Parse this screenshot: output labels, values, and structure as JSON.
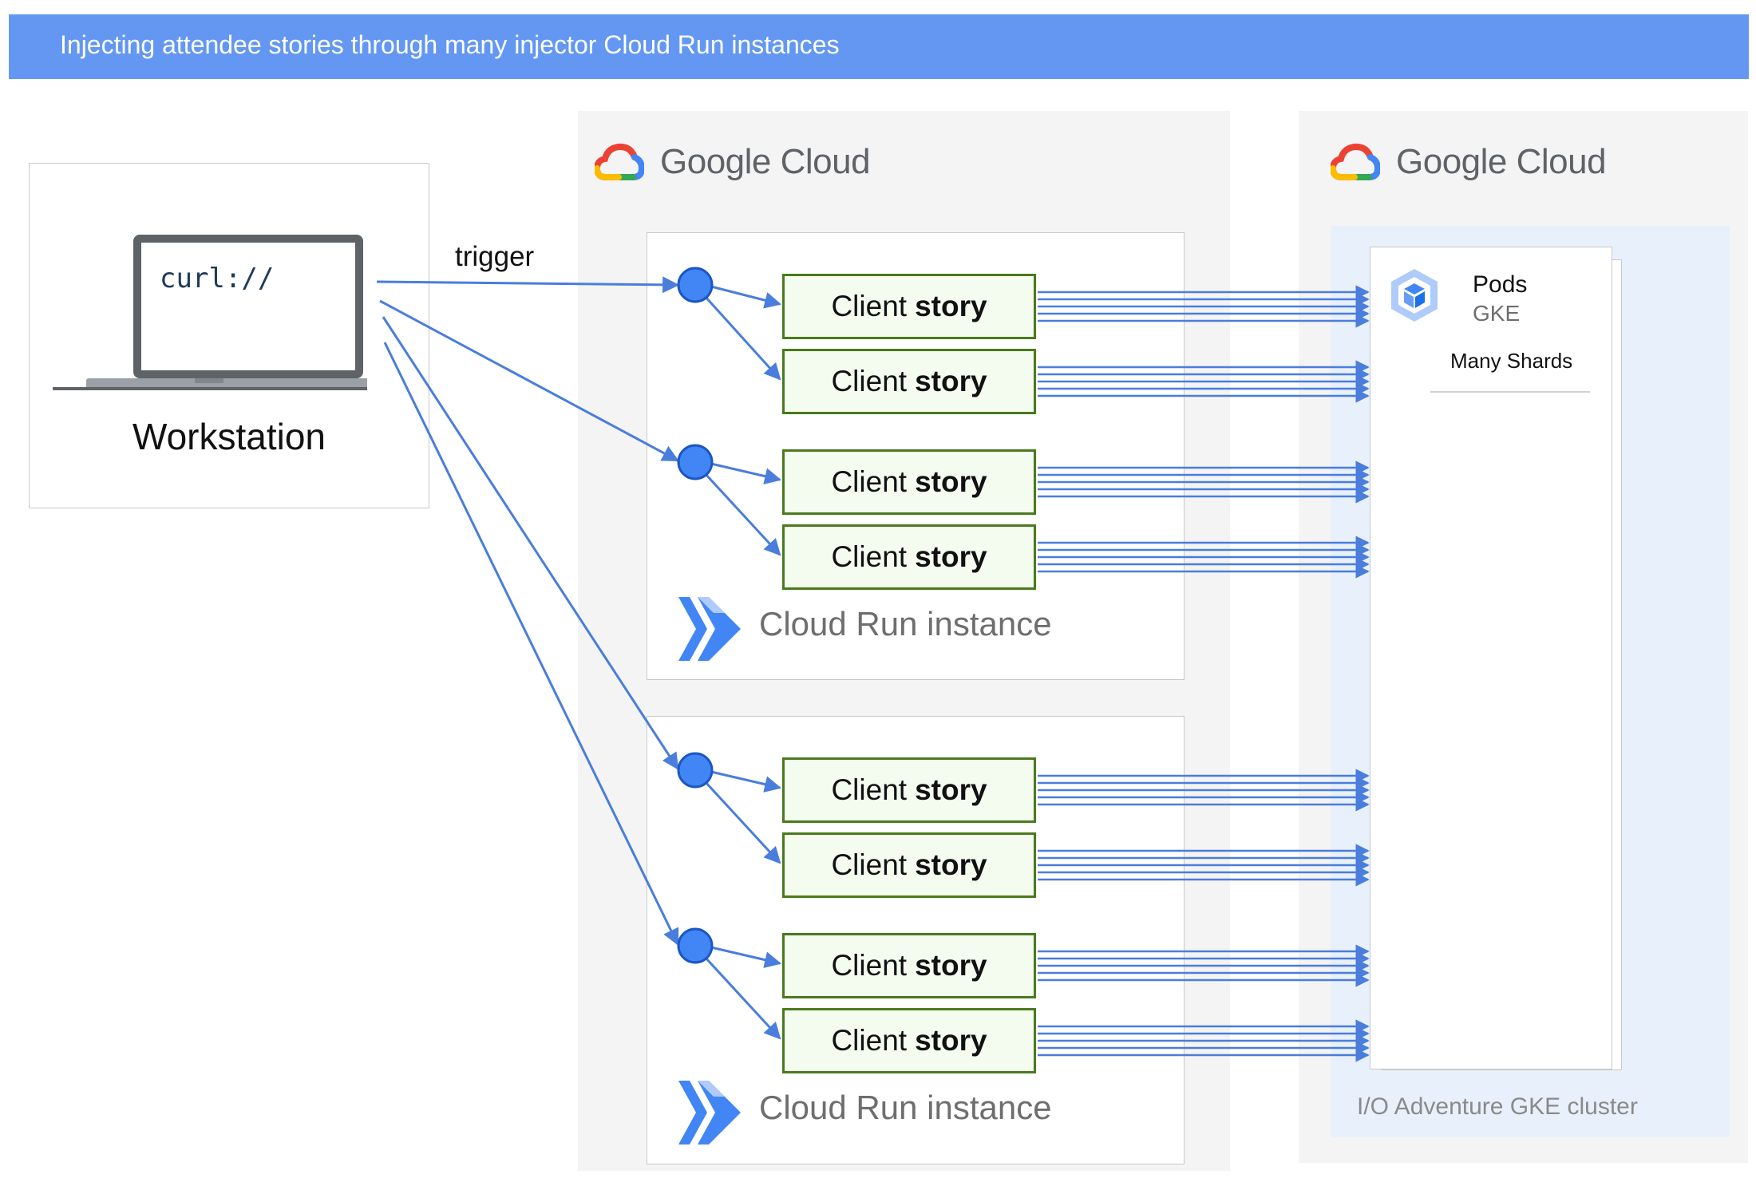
{
  "header": {
    "title": "Injecting attendee stories through many injector Cloud Run instances"
  },
  "google_cloud": {
    "logo_text": "Google Cloud"
  },
  "workstation": {
    "label": "Workstation",
    "screen_text": "curl://"
  },
  "trigger": {
    "label": "trigger"
  },
  "cloud_run": {
    "instance_label": "Cloud Run instance",
    "story_label_regular": "Client",
    "story_label_bold": "story"
  },
  "gke": {
    "pods_title": "Pods",
    "pods_subtitle": "GKE",
    "shards_label": "Many Shards",
    "cluster_label": "I/O Adventure GKE cluster"
  },
  "colors": {
    "header_bg": "#6397f2",
    "arrow_blue": "#4a7ddc",
    "story_border": "#4a7a1c",
    "story_fill": "#f4fbef"
  }
}
